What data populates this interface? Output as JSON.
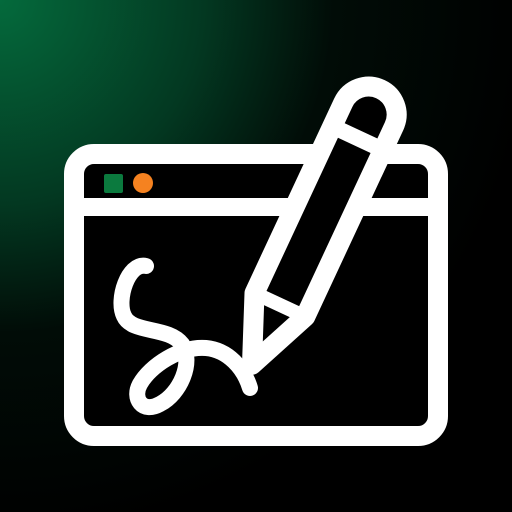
{
  "icon": {
    "name": "signature-app-icon",
    "depicts": [
      "browser-window-icon",
      "pencil-icon",
      "signature-squiggle"
    ],
    "colors": {
      "background_glow": "#046a3c",
      "background_dark": "#000000",
      "stroke": "#ffffff",
      "window_fill": "#000000",
      "dot_green": "#0b7a3e",
      "dot_orange": "#f58220"
    }
  }
}
